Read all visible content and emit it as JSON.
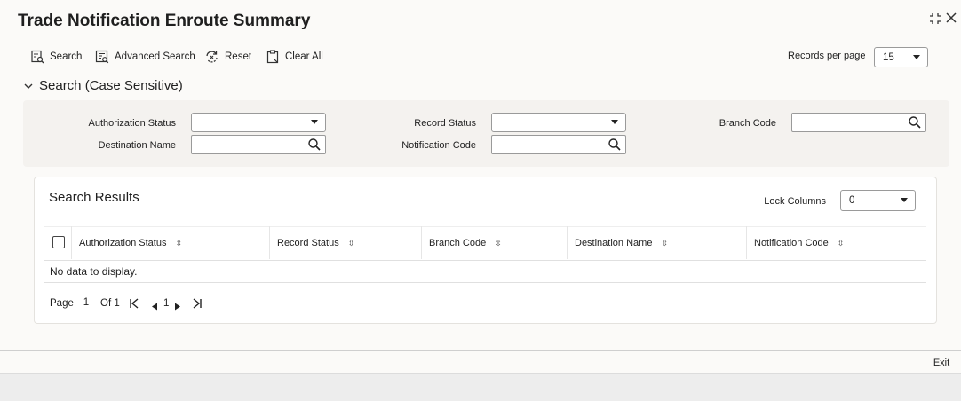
{
  "window": {
    "title": "Trade Notification Enroute Summary"
  },
  "toolbar": {
    "search": "Search",
    "advanced_search": "Advanced Search",
    "reset": "Reset",
    "clear_all": "Clear All",
    "records_per_page_label": "Records per page",
    "records_per_page_value": "15"
  },
  "search_section": {
    "title": "Search (Case Sensitive)",
    "fields": {
      "authorization_status": {
        "label": "Authorization Status",
        "value": ""
      },
      "record_status": {
        "label": "Record Status",
        "value": ""
      },
      "branch_code": {
        "label": "Branch Code",
        "value": ""
      },
      "destination_name": {
        "label": "Destination Name",
        "value": ""
      },
      "notification_code": {
        "label": "Notification Code",
        "value": ""
      }
    }
  },
  "results": {
    "title": "Search Results",
    "lock_columns_label": "Lock Columns",
    "lock_columns_value": "0",
    "columns": [
      "Authorization Status",
      "Record Status",
      "Branch Code",
      "Destination Name",
      "Notification Code"
    ],
    "empty_message": "No data to display.",
    "pager": {
      "page_label": "Page",
      "page_value": "1",
      "of_label": "Of 1",
      "current": "1"
    }
  },
  "footer": {
    "exit": "Exit"
  },
  "colors": {
    "background": "#fbfaf8",
    "panel": "#f4f2ef",
    "text": "#1f1f1f"
  }
}
